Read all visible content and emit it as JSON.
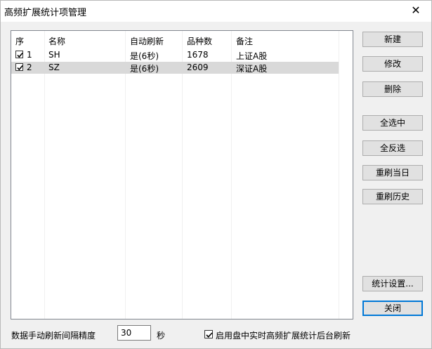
{
  "window": {
    "title": "高频扩展统计项管理",
    "close_glyph": "✕"
  },
  "list": {
    "columns": [
      "序",
      "名称",
      "自动刷新",
      "品种数",
      "备注"
    ],
    "rows": [
      {
        "index": "1",
        "name": "SH",
        "refresh": "是(6秒)",
        "count": "1678",
        "note": "上证A股",
        "checked": true,
        "selected": false
      },
      {
        "index": "2",
        "name": "SZ",
        "refresh": "是(6秒)",
        "count": "2609",
        "note": "深证A股",
        "checked": true,
        "selected": true
      }
    ]
  },
  "buttons": {
    "new": "新建",
    "edit": "修改",
    "delete": "删除",
    "select_all": "全选中",
    "invert": "全反选",
    "refresh_today": "重刷当日",
    "refresh_history": "重刷历史",
    "settings": "统计设置...",
    "close": "关闭"
  },
  "bottom": {
    "interval_label": "数据手动刷新间隔精度",
    "interval_value": "30",
    "unit": "秒",
    "background_refresh_label": "启用盘中实时高频扩展统计后台刷新",
    "background_refresh_checked": true
  },
  "colors": {
    "selected_row": "#d9d9d9",
    "default_button_border": "#0078d7",
    "button_face": "#e1e1e1"
  }
}
